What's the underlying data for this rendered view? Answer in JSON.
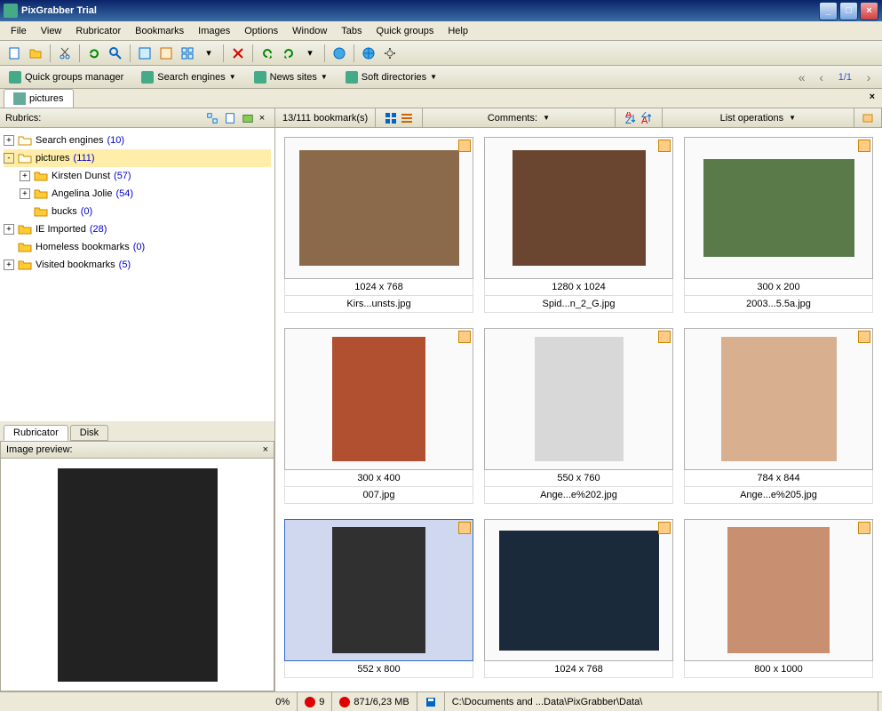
{
  "window": {
    "title": "PixGrabber Trial"
  },
  "menu": [
    "File",
    "View",
    "Rubricator",
    "Bookmarks",
    "Images",
    "Options",
    "Window",
    "Tabs",
    "Quick groups",
    "Help"
  ],
  "quickgroups": {
    "manager": "Quick groups manager",
    "items": [
      "Search engines",
      "News sites",
      "Soft directories"
    ]
  },
  "nav": {
    "page": "1/1"
  },
  "doctab": "pictures",
  "sidebar": {
    "rubrics_label": "Rubrics:",
    "tree": [
      {
        "label": "Search engines",
        "count": "(10)",
        "open": true,
        "indent": 0,
        "exp": "+"
      },
      {
        "label": "pictures",
        "count": "(111)",
        "open": true,
        "indent": 0,
        "exp": "-",
        "sel": true
      },
      {
        "label": "Kirsten Dunst",
        "count": "(57)",
        "open": false,
        "indent": 1,
        "exp": "+"
      },
      {
        "label": "Angelina Jolie",
        "count": "(54)",
        "open": false,
        "indent": 1,
        "exp": "+"
      },
      {
        "label": "bucks",
        "count": "(0)",
        "open": false,
        "indent": 1,
        "exp": ""
      },
      {
        "label": "IE Imported",
        "count": "(28)",
        "open": false,
        "indent": 0,
        "exp": "+"
      },
      {
        "label": "Homeless bookmarks",
        "count": "(0)",
        "open": false,
        "indent": 0,
        "exp": ""
      },
      {
        "label": "Visited bookmarks",
        "count": "(5)",
        "open": false,
        "indent": 0,
        "exp": "+"
      }
    ],
    "tabs": {
      "rubricator": "Rubricator",
      "disk": "Disk"
    },
    "preview_label": "Image preview:"
  },
  "content": {
    "header": {
      "count": "13/111 bookmark(s)",
      "comments": "Comments:",
      "listops": "List operations"
    },
    "thumbs": [
      {
        "dim": "1024 x 768",
        "file": "Kirs...unsts.jpg",
        "w": 180,
        "h": 130,
        "bg": "#8a6a4a"
      },
      {
        "dim": "1280 x 1024",
        "file": "Spid...n_2_G.jpg",
        "w": 150,
        "h": 130,
        "bg": "#6a4530"
      },
      {
        "dim": "300 x 200",
        "file": "2003...5.5a.jpg",
        "w": 170,
        "h": 110,
        "bg": "#5a7a4a"
      },
      {
        "dim": "300 x 400",
        "file": "007.jpg",
        "w": 105,
        "h": 140,
        "bg": "#b05030"
      },
      {
        "dim": "550 x 760",
        "file": "Ange...e%202.jpg",
        "w": 100,
        "h": 140,
        "bg": "#d8d8d8"
      },
      {
        "dim": "784 x 844",
        "file": "Ange...e%205.jpg",
        "w": 130,
        "h": 140,
        "bg": "#d8b090"
      },
      {
        "dim": "552 x 800",
        "file": "",
        "w": 105,
        "h": 150,
        "bg": "#303030",
        "sel": true
      },
      {
        "dim": "1024 x 768",
        "file": "",
        "w": 180,
        "h": 135,
        "bg": "#1a2a3a"
      },
      {
        "dim": "800 x 1000",
        "file": "",
        "w": 115,
        "h": 145,
        "bg": "#c89070"
      }
    ]
  },
  "status": {
    "pct": "0%",
    "down": "9",
    "size": "871/6,23 MB",
    "path": "C:\\Documents and ...Data\\PixGrabber\\Data\\"
  }
}
